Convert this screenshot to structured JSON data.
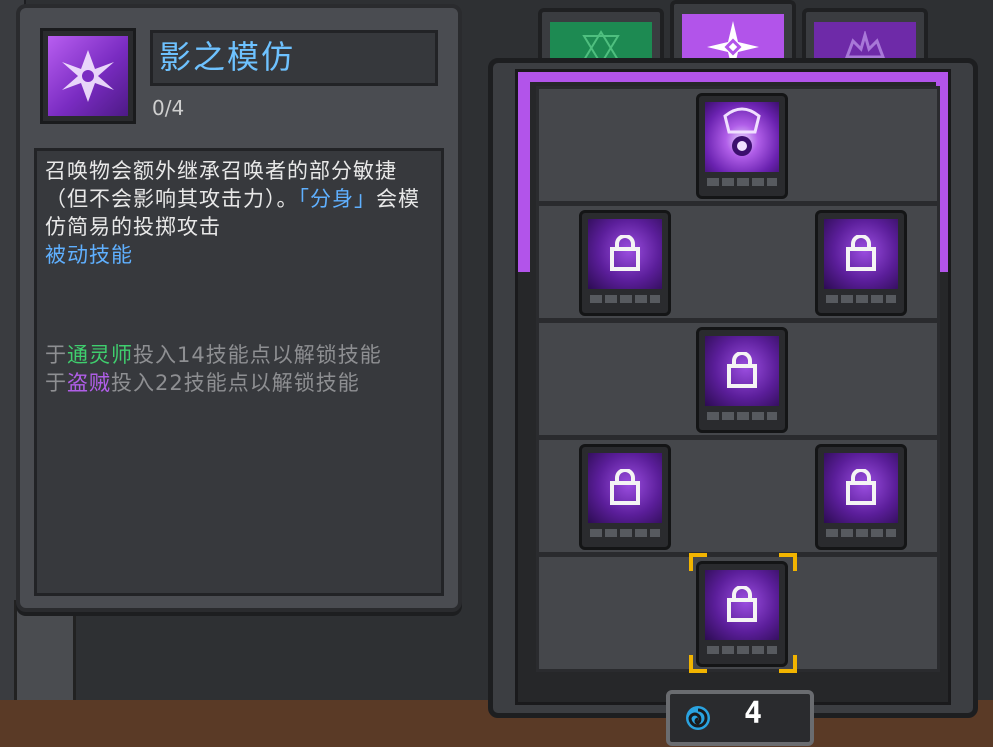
{
  "skill": {
    "icon": "shuriken-icon",
    "title": "影之模仿",
    "rank": "0/4",
    "description_before": "召唤物会额外继承召唤者的部分敏捷（但不会影响其攻击力）。",
    "description_quote": "「分身」",
    "description_after": "会模仿简易的投掷攻击",
    "type": "被动技能",
    "req1_prefix": "于",
    "req1_class": "通灵师",
    "req1_suffix": "投入14技能点以解锁技能",
    "req2_prefix": "于",
    "req2_class": "盗贼",
    "req2_suffix": "投入22技能点以解锁技能"
  },
  "tabs": [
    {
      "icon": "hexagram-icon",
      "color": "#1d8a52",
      "active": false
    },
    {
      "icon": "shuriken-star-icon",
      "color": "#b254ea",
      "active": true
    },
    {
      "icon": "crown-emblem-icon",
      "color": "#6e2aa8",
      "active": false
    }
  ],
  "tree": {
    "nodes": [
      {
        "row": 1,
        "col": "center",
        "locked": false,
        "icon": "summon-skill-icon"
      },
      {
        "row": 2,
        "col": "left",
        "locked": true,
        "icon": "lock-icon"
      },
      {
        "row": 2,
        "col": "right",
        "locked": true,
        "icon": "lock-icon"
      },
      {
        "row": 3,
        "col": "center",
        "locked": true,
        "icon": "lock-icon"
      },
      {
        "row": 4,
        "col": "left",
        "locked": true,
        "icon": "lock-icon"
      },
      {
        "row": 4,
        "col": "right",
        "locked": true,
        "icon": "lock-icon"
      },
      {
        "row": 5,
        "col": "center",
        "locked": true,
        "selected": true,
        "icon": "lock-icon"
      }
    ]
  },
  "skill_points": {
    "icon": "swirl-icon",
    "value": "4"
  },
  "colors": {
    "title": "#6ec2ff",
    "necromancer": "#3fcf6e",
    "rogue": "#b05ee8",
    "accent_purple": "#b254ea",
    "selection": "#f2b400"
  }
}
